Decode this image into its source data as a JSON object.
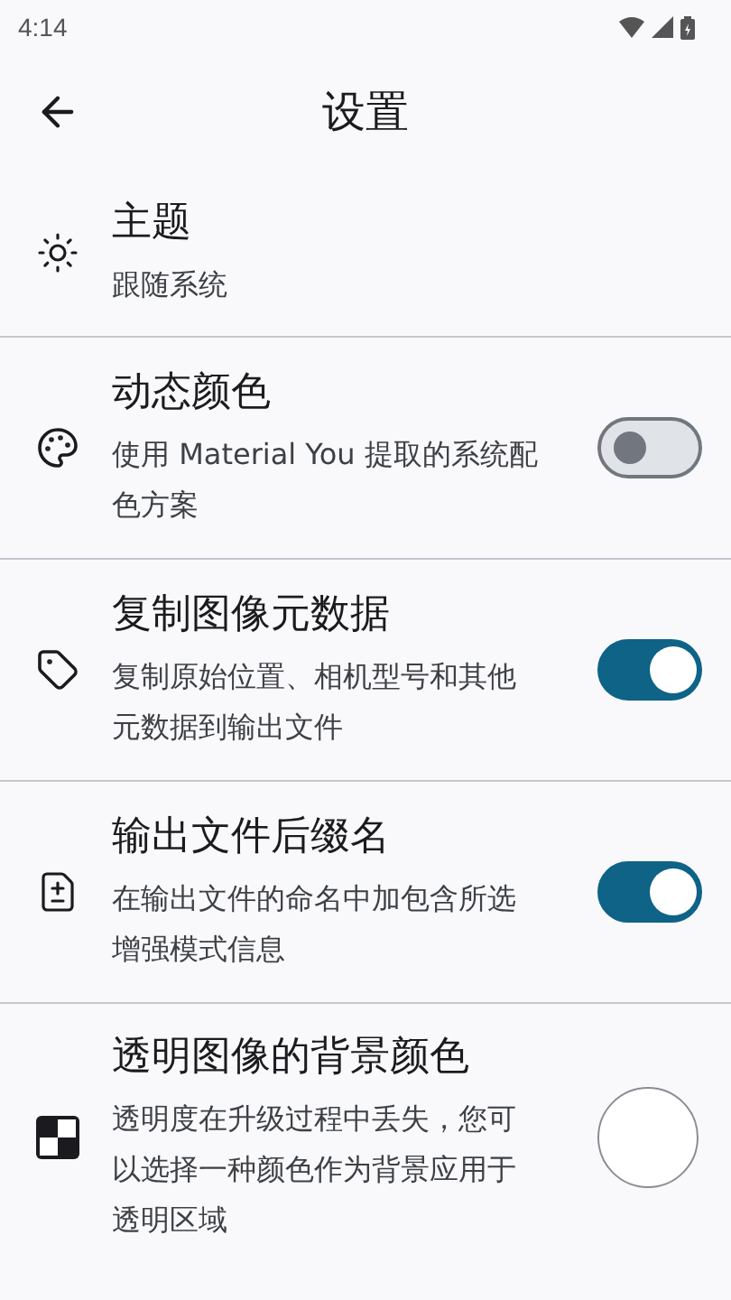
{
  "status_bar": {
    "time": "4:14"
  },
  "app_bar": {
    "title": "设置"
  },
  "settings": [
    {
      "kind": "plain",
      "title": "主题",
      "description": "跟随系统"
    },
    {
      "kind": "switch",
      "title": "动态颜色",
      "description": "使用 Material You 提取的系统配色方案",
      "on": false
    },
    {
      "kind": "switch",
      "title": "复制图像元数据",
      "description": "复制原始位置、相机型号和其他元数据到输出文件",
      "on": true
    },
    {
      "kind": "switch",
      "title": "输出文件后缀名",
      "description": "在输出文件的命名中加包含所选增强模式信息",
      "on": true
    },
    {
      "kind": "color",
      "title": "透明图像的背景颜色",
      "description": "透明度在升级过程中丢失，您可以选择一种颜色作为背景应用于透明区域",
      "color": "#ffffff"
    }
  ]
}
